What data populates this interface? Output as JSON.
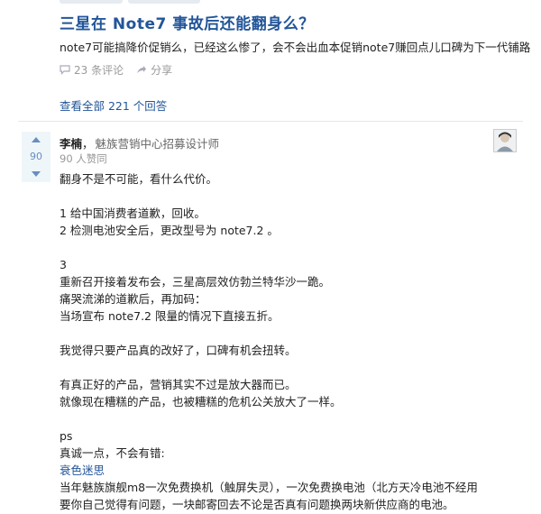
{
  "question": {
    "title": "三星在 Note7 事故后还能翻身么？",
    "description": "note7可能搞降价促销么，已经这么惨了，会不会出血本促销note7赚回点儿口碑为下一代铺路",
    "comments_label": "23 条评论",
    "share_label": "分享",
    "view_all_label": "查看全部 221 个回答"
  },
  "answer": {
    "vote_count": "90",
    "author_name": "李楠",
    "author_sep": "，",
    "author_bio": "魅族营销中心招募设计师",
    "vote_info": "90 人赞同",
    "lines": [
      "翻身不是不可能，看什么代价。",
      "",
      "1 给中国消费者道歉，回收。",
      "2 检测电池安全后，更改型号为 note7.2 。",
      "",
      "3",
      "重新召开接着发布会，三星高层效仿勃兰特华沙一跪。",
      "痛哭流涕的道歉后，再加码：",
      "当场宣布 note7.2 限量的情况下直接五折。",
      "",
      "我觉得只要产品真的改好了，口碑有机会扭转。",
      "",
      "有真正好的产品，营销其实不过是放大器而已。",
      "就像现在糟糕的产品，也被糟糕的危机公关放大了一样。",
      "",
      "ps",
      "真诚一点，不会有错:",
      "衰色迷思",
      "当年魅族旗舰m8一次免费换机（触屏失灵），一次免费换电池（北方天冷电池不经用",
      "要你自己觉得有问题，一块邮寄回去不论是否真有问题换两块新供应商的电池。"
    ],
    "link_line_index": 17
  },
  "colors": {
    "link": "#225599",
    "vote_bg": "#eff6fa",
    "vote_text": "#698ebf",
    "muted": "#999999"
  }
}
